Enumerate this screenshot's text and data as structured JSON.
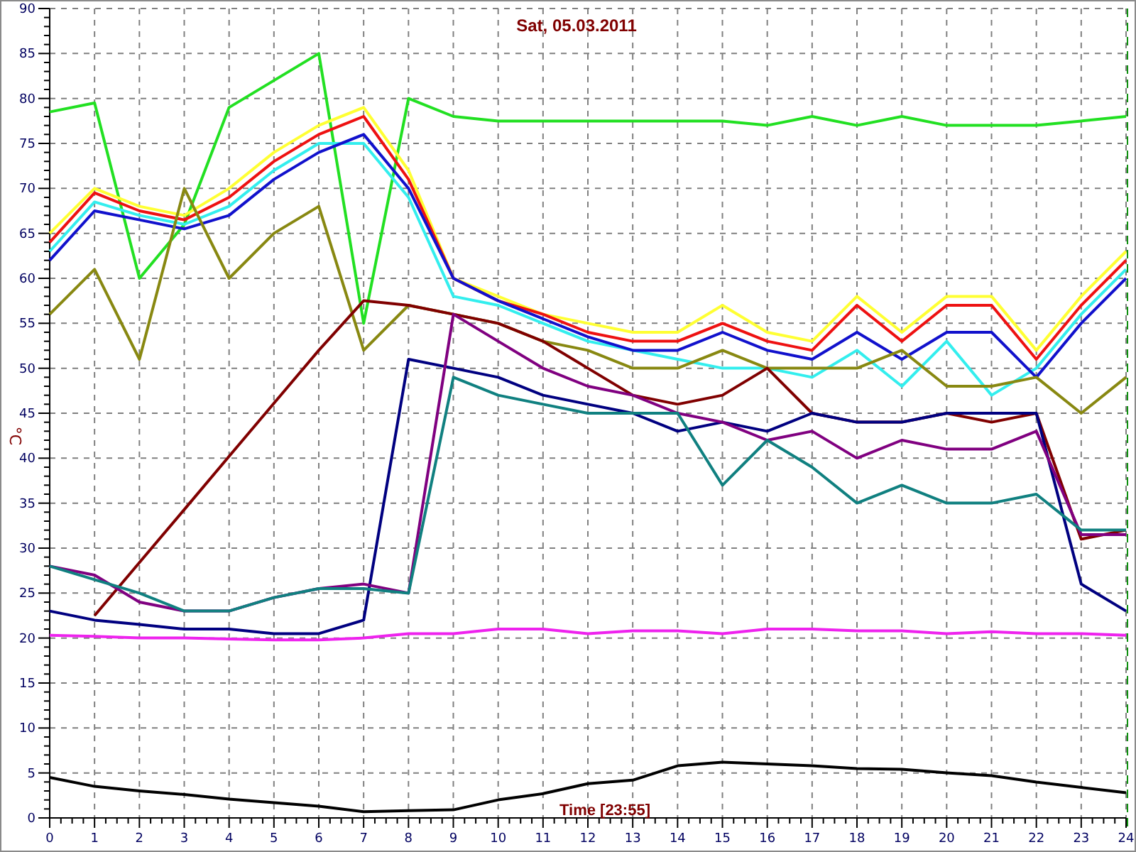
{
  "chart_data": {
    "type": "line",
    "title": "Sat, 05.03.2011",
    "xlabel": "Time [23:55]",
    "ylabel": "°C",
    "x": [
      0,
      1,
      2,
      3,
      4,
      5,
      6,
      7,
      8,
      9,
      10,
      11,
      12,
      13,
      14,
      15,
      16,
      17,
      18,
      19,
      20,
      21,
      22,
      23,
      24
    ],
    "grid": true,
    "xlim": [
      0,
      24
    ],
    "ylim": [
      0,
      90
    ],
    "xticks": [
      0,
      1,
      2,
      3,
      4,
      5,
      6,
      7,
      8,
      9,
      10,
      11,
      12,
      13,
      14,
      15,
      16,
      17,
      18,
      19,
      20,
      21,
      22,
      23,
      24
    ],
    "yticks": [
      0,
      5,
      10,
      15,
      20,
      25,
      30,
      35,
      40,
      45,
      50,
      55,
      60,
      65,
      70,
      75,
      80,
      85,
      90
    ],
    "series": [
      {
        "color": "#22e022",
        "values": [
          78.5,
          79.5,
          60,
          66,
          79,
          82,
          85,
          55,
          80,
          78,
          77.5,
          77.5,
          77.5,
          77.5,
          77.5,
          77.5,
          77,
          78,
          77,
          78,
          77,
          77,
          77,
          77.5,
          78
        ]
      },
      {
        "color": "#ffff33",
        "values": [
          65,
          70,
          68,
          67,
          70,
          74,
          77,
          79,
          72,
          60,
          58,
          56,
          55,
          54,
          54,
          57,
          54,
          53,
          58,
          54,
          58,
          58,
          52,
          58,
          63
        ]
      },
      {
        "color": "#ee1111",
        "values": [
          64,
          69.5,
          67.5,
          66.5,
          69,
          73,
          76,
          78,
          71,
          60,
          57.5,
          56,
          54,
          53,
          53,
          55,
          53,
          52,
          57,
          53,
          57,
          57,
          51,
          57,
          62
        ]
      },
      {
        "color": "#33eeee",
        "values": [
          63,
          68.5,
          67,
          66,
          68,
          72,
          75,
          75,
          69,
          58,
          57,
          55,
          53,
          52,
          51,
          50,
          50,
          49,
          52,
          48,
          53,
          47,
          50,
          56,
          61
        ]
      },
      {
        "color": "#1111cc",
        "values": [
          62,
          67.5,
          66.5,
          65.5,
          67,
          71,
          74,
          76,
          70,
          60,
          57.5,
          55.5,
          53.5,
          52,
          52,
          54,
          52,
          51,
          54,
          51,
          54,
          54,
          49,
          55,
          60
        ]
      },
      {
        "color": "#888811",
        "values": [
          56,
          61,
          51,
          70,
          60,
          65,
          68,
          52,
          57,
          56,
          55,
          53,
          52,
          50,
          50,
          52,
          50,
          50,
          50,
          52,
          48,
          48,
          49,
          45,
          49
        ]
      },
      {
        "color": "#800000",
        "values": [
          null,
          22.5,
          28.4,
          34.3,
          40.2,
          46.1,
          52,
          57.5,
          57,
          56,
          55,
          53,
          50,
          47,
          46,
          47,
          50,
          45,
          44,
          44,
          45,
          44,
          45,
          31,
          32
        ]
      },
      {
        "color": "#000080",
        "values": [
          23,
          22,
          21.5,
          21,
          21,
          20.5,
          20.5,
          22,
          51,
          50,
          49,
          47,
          46,
          45,
          43,
          44,
          43,
          45,
          44,
          44,
          45,
          45,
          45,
          26,
          23
        ]
      },
      {
        "color": "#800080",
        "values": [
          28,
          27,
          24,
          23,
          23,
          24.5,
          25.5,
          26,
          25,
          56,
          53,
          50,
          48,
          47,
          45,
          44,
          42,
          43,
          40,
          42,
          41,
          41,
          43,
          31.5,
          31.5
        ]
      },
      {
        "color": "#108080",
        "values": [
          28,
          26.5,
          25,
          23,
          23,
          24.5,
          25.5,
          25.5,
          25,
          49,
          47,
          46,
          45,
          45,
          45,
          37,
          42,
          39,
          35,
          37,
          35,
          35,
          36,
          32,
          32
        ]
      },
      {
        "color": "#ee22ee",
        "values": [
          20.3,
          20.2,
          20,
          20,
          19.9,
          19.8,
          19.8,
          20,
          20.5,
          20.5,
          21,
          21,
          20.5,
          20.8,
          20.8,
          20.5,
          21,
          21,
          20.8,
          20.8,
          20.5,
          20.7,
          20.5,
          20.5,
          20.3
        ]
      },
      {
        "color": "#000000",
        "values": [
          4.5,
          3.5,
          3,
          2.6,
          2.1,
          1.7,
          1.3,
          0.7,
          0.8,
          0.9,
          2,
          2.7,
          3.8,
          4.2,
          5.8,
          6.2,
          6,
          5.8,
          5.5,
          5.4,
          5,
          4.7,
          4,
          3.4,
          2.8
        ]
      }
    ]
  }
}
